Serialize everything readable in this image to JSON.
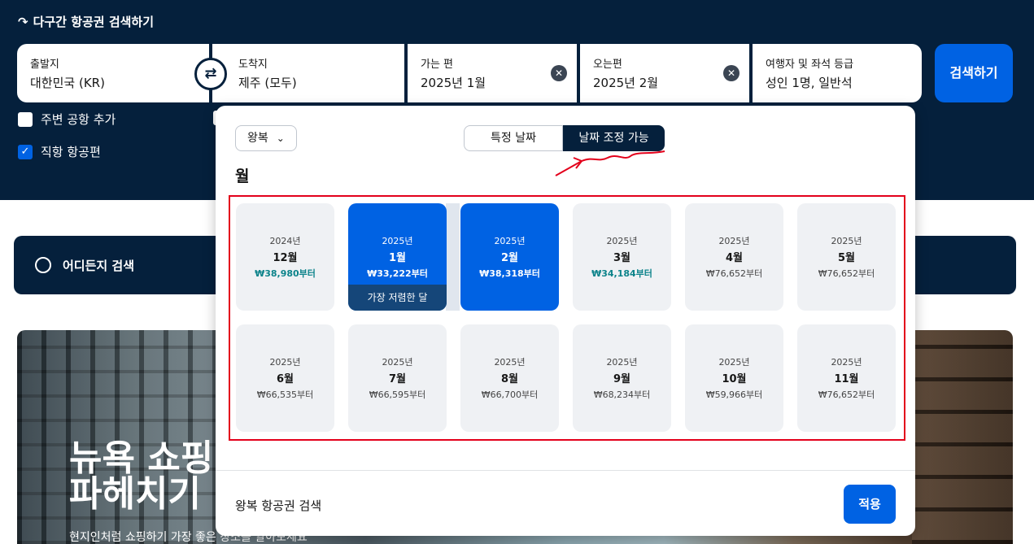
{
  "header": {
    "multi_city_label": "다구간 항공권 검색하기",
    "origin": {
      "label": "출발지",
      "value": "대한민국 (KR)"
    },
    "destination": {
      "label": "도착지",
      "value": "제주 (모두)"
    },
    "depart": {
      "label": "가는 편",
      "value": "2025년 1월"
    },
    "return": {
      "label": "오는편",
      "value": "2025년 2월"
    },
    "travelers": {
      "label": "여행자 및 좌석 등급",
      "value": "성인 1명, 일반석"
    },
    "search_button": "검색하기",
    "swap_icon": "⇄",
    "clear_icon": "✕",
    "checkboxes": {
      "nearby": {
        "label": "주변 공항 추가",
        "checked": false
      },
      "direct": {
        "label": "직항 항공편",
        "checked": true
      }
    }
  },
  "page": {
    "explore_label": "어디든지 검색",
    "hero_title_line1": "뉴욕 쇼핑",
    "hero_title_line2": "파헤치기",
    "hero_subtitle": "현지인처럼 쇼핑하기 가장 좋은 장소를 알아보세요"
  },
  "popup": {
    "trip_type": "왕복",
    "toggle": {
      "specific": "특정 날짜",
      "flexible": "날짜 조정 가능",
      "active": "flexible"
    },
    "heading": "월",
    "months": [
      {
        "year": "2024년",
        "month": "12월",
        "price": "₩38,980부터",
        "cheap": true,
        "selected": false
      },
      {
        "year": "2025년",
        "month": "1월",
        "price": "₩33,222부터",
        "cheap": true,
        "selected": true,
        "tag": "가장 저렴한 달"
      },
      {
        "year": "2025년",
        "month": "2월",
        "price": "₩38,318부터",
        "cheap": true,
        "selected": true
      },
      {
        "year": "2025년",
        "month": "3월",
        "price": "₩34,184부터",
        "cheap": true,
        "selected": false
      },
      {
        "year": "2025년",
        "month": "4월",
        "price": "₩76,652부터",
        "cheap": false,
        "selected": false
      },
      {
        "year": "2025년",
        "month": "5월",
        "price": "₩76,652부터",
        "cheap": false,
        "selected": false
      },
      {
        "year": "2025년",
        "month": "6월",
        "price": "₩66,535부터",
        "cheap": false,
        "selected": false
      },
      {
        "year": "2025년",
        "month": "7월",
        "price": "₩66,595부터",
        "cheap": false,
        "selected": false
      },
      {
        "year": "2025년",
        "month": "8월",
        "price": "₩66,700부터",
        "cheap": false,
        "selected": false
      },
      {
        "year": "2025년",
        "month": "9월",
        "price": "₩68,234부터",
        "cheap": false,
        "selected": false
      },
      {
        "year": "2025년",
        "month": "10월",
        "price": "₩59,966부터",
        "cheap": false,
        "selected": false
      },
      {
        "year": "2025년",
        "month": "11월",
        "price": "₩76,652부터",
        "cheap": false,
        "selected": false
      }
    ],
    "footer_text": "왕복 항공권 검색",
    "apply_button": "적용"
  },
  "colors": {
    "header_bg": "#05203c",
    "primary": "#0062e3",
    "cheap_price": "#0c838a",
    "annotation_red": "#e3001b"
  }
}
